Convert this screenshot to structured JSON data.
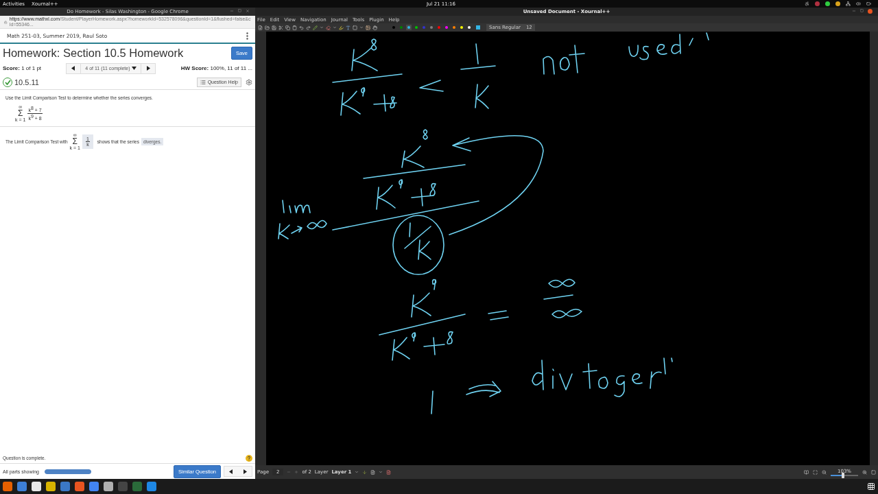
{
  "top_bar": {
    "activities": "Activities",
    "app_menu": "Xournal++",
    "clock": "Jul 21  11:16"
  },
  "browser": {
    "title": "Do Homework - Silas Washington - Google Chrome",
    "url_host": "https://www.mathxl.com",
    "url_path": "/Student/PlayerHomework.aspx?homeworkId=532578096&questionId=1&flushed=false&cId=55346...",
    "course": "Math 251-03, Summer 2019, Raul Soto",
    "heading": "Homework: Section 10.5 Homework",
    "save": "Save",
    "score_label": "Score:",
    "score": "1 of 1 pt",
    "nav": "4 of 11 (11 complete)",
    "hw_score_label": "HW Score:",
    "hw_score": "100%, 11 of 11 ...",
    "question_id": "10.5.11",
    "question_correct": true,
    "question_help": "Question Help",
    "instruction": "Use the Limit Comparison Test to determine whether the series converges.",
    "series": {
      "upper": "∞",
      "sigma": "Σ",
      "lower": "k = 1",
      "numerator": "k$^{8}$ + 7",
      "denominator": "k$^{9}$ + 8"
    },
    "answer": {
      "before": "The Limit Comparison Test with",
      "upper": "∞",
      "sigma": "Σ",
      "lower": "k = 1",
      "numerator": "1",
      "denominator": "k",
      "after": "shows that the series",
      "choice": "diverges."
    },
    "status": "Question is complete.",
    "parts": "All parts showing",
    "progress": {
      "level": 1
    },
    "similar": "Similar Question"
  },
  "xournal": {
    "title": "Unsaved Document - Xournal++",
    "menu": [
      "File",
      "Edit",
      "View",
      "Navigation",
      "Journal",
      "Tools",
      "Plugin",
      "Help"
    ],
    "colors": [
      {
        "color": "#000000",
        "selected": false
      },
      {
        "color": "#008000",
        "selected": false
      },
      {
        "color": "#33b5e5",
        "selected": true
      },
      {
        "color": "#00c000",
        "selected": false
      },
      {
        "color": "#3333cc",
        "selected": false
      },
      {
        "color": "#808080",
        "selected": false
      },
      {
        "color": "#ff0000",
        "selected": false
      },
      {
        "color": "#ff00ff",
        "selected": false
      },
      {
        "color": "#ff8000",
        "selected": false
      },
      {
        "color": "#ffff00",
        "selected": false
      },
      {
        "color": "#ffffff",
        "selected": false
      }
    ],
    "font": "Sans Regular",
    "font_size": "12",
    "status": {
      "page_label": "Page",
      "page": "2",
      "of": "of 2",
      "layer_label": "Layer",
      "layer": "Layer 1",
      "zoom": "103%",
      "zoom_slider": {
        "level": 0.45
      }
    }
  }
}
